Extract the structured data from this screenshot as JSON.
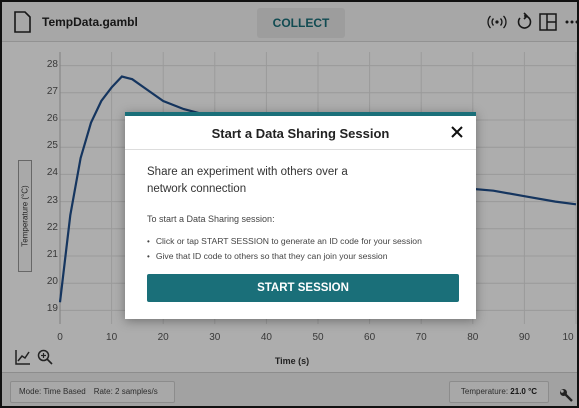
{
  "app": {
    "file_name": "TempData.gambl",
    "collect_label": "COLLECT"
  },
  "toolbar": {
    "icons": [
      "file-icon",
      "wireless-sensor-icon",
      "replay-icon",
      "layout-icon",
      "more-icon"
    ]
  },
  "graph": {
    "y_axis_label": "Temperature (°C)",
    "x_axis_label": "Time (s)",
    "y_ticks": [
      "28",
      "27",
      "26",
      "25",
      "24",
      "23",
      "22",
      "21",
      "20",
      "19"
    ],
    "x_ticks": [
      "0",
      "10",
      "20",
      "30",
      "40",
      "50",
      "60",
      "70",
      "80",
      "90",
      "10"
    ],
    "line_color": "#1f4e8c"
  },
  "chart_data": {
    "type": "line",
    "xlabel": "Time (s)",
    "ylabel": "Temperature (°C)",
    "xlim": [
      0,
      100
    ],
    "ylim": [
      18.5,
      28.5
    ],
    "grid": true,
    "series": [
      {
        "x": [
          0,
          2,
          4,
          6,
          8,
          10,
          12,
          14,
          17,
          20,
          24,
          28,
          32,
          78,
          84,
          90,
          96,
          100
        ],
        "values": [
          19.3,
          22.5,
          24.6,
          25.9,
          26.7,
          27.2,
          27.6,
          27.5,
          27.1,
          26.7,
          26.4,
          26.2,
          26.0,
          23.5,
          23.4,
          23.2,
          23.0,
          22.9
        ]
      }
    ]
  },
  "status": {
    "mode": "Mode: Time Based",
    "rate": "Rate: 2 samples/s",
    "temp_label": "Temperature:",
    "temp_value": "21.0 °C"
  },
  "modal": {
    "title": "Start a Data Sharing Session",
    "description": "Share an experiment with others over a network connection",
    "instructions": "To start a Data Sharing session:",
    "bullets": [
      "Click or tap START SESSION to generate an ID code for your session",
      "Give that ID code to others so that they can join your session"
    ],
    "start_button": "START SESSION",
    "accent_color": "#1a6f79"
  }
}
